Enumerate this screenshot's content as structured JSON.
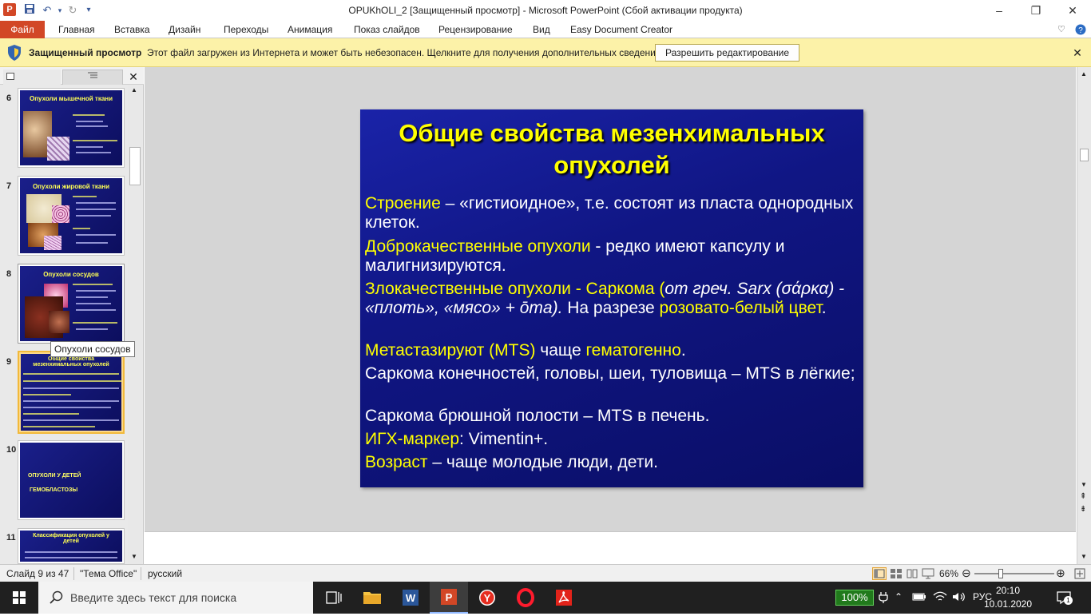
{
  "window": {
    "title": "OPUKhOLI_2 [Защищенный просмотр]  -  Microsoft PowerPoint (Сбой активации продукта)",
    "app_letter": "P"
  },
  "ribbon": {
    "file_tab": "Файл",
    "tabs": [
      "Главная",
      "Вставка",
      "Дизайн",
      "Переходы",
      "Анимация",
      "Показ слайдов",
      "Рецензирование",
      "Вид",
      "Easy Document Creator"
    ]
  },
  "protected_view": {
    "title": "Защищенный просмотр",
    "message": "Этот файл загружен из Интернета и может быть небезопасен. Щелкните для получения дополнительных сведений.",
    "enable_button": "Разрешить редактирование"
  },
  "slides_panel": {
    "thumbnails": [
      {
        "number": "6",
        "title": "Опухоли  мышечной ткани"
      },
      {
        "number": "7",
        "title": "Опухоли  жировой ткани"
      },
      {
        "number": "8",
        "title": "Опухоли  сосудов"
      },
      {
        "number": "9",
        "title": "Общие свойства мезенхимальных опухолей"
      },
      {
        "number": "10",
        "title": "ОПУХОЛИ У ДЕТЕЙ",
        "subtitle": "ГЕМОБЛАСТОЗЫ"
      },
      {
        "number": "11",
        "title": "Классификация  опухолей  у детей"
      }
    ],
    "tooltip": "Опухоли сосудов"
  },
  "slide": {
    "title": "Общие свойства мезенхимальных опухолей",
    "lines": {
      "l1a": "Строение",
      "l1b": "  – «гистиоидное», т.е. состоят из пласта однородных клеток.",
      "l2a": "Доброкачественные опухоли",
      "l2b": " - редко имеют капсулу и малигнизируются.",
      "l3a": "Злокачественные опухоли - Саркома (",
      "l3b": "от греч. Sarx (σάρκα) - «плоть», «мясо» + ōma).",
      "l3c": "  На разрезе ",
      "l3d": "розовато-белый цвет",
      "l3e": ".",
      "l4a": "Метастазируют  (MTS)",
      "l4b": " чаще ",
      "l4c": "гематогенно",
      "l4d": ".",
      "l5": " Саркома конечностей, головы, шеи, туловища – MTS в лёгкие;",
      "l6": "  Саркома брюшной полости – MTS в печень.",
      "l7a": "ИГХ-маркер",
      "l7b": ": Vimentin+.",
      "l8a": "Возраст",
      "l8b": "  – чаще молодые люди, дети."
    }
  },
  "status": {
    "slide_of": "Слайд 9 из 47",
    "theme": "\"Тема Office\"",
    "language": "русский",
    "zoom": "66%"
  },
  "taskbar": {
    "search_placeholder": "Введите здесь текст для поиска",
    "battery": "100%",
    "lang": "РУС",
    "time": "20:10",
    "date": "10.01.2020",
    "notif_count": "1"
  },
  "colors": {
    "ppt_accent": "#d24726",
    "slide_bg": "#10168a",
    "slide_highlight": "#ffff00",
    "protected_bar": "#fcf2a8"
  }
}
